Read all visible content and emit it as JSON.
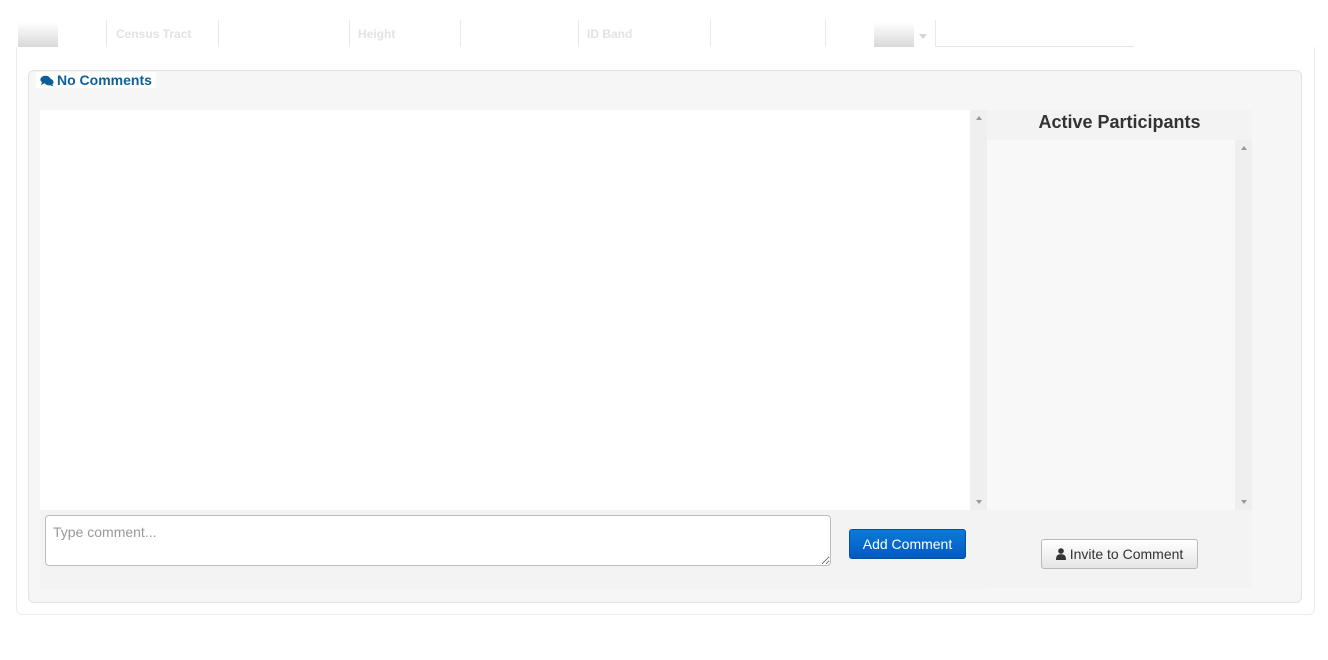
{
  "table_header": {
    "columns": [
      "Census Tract",
      "Height",
      "ID Band"
    ]
  },
  "comments": {
    "legend": "No Comments",
    "input_placeholder": "Type comment...",
    "add_button": "Add Comment"
  },
  "participants": {
    "title": "Active Participants",
    "invite_button": "Invite to Comment"
  },
  "icons": {
    "comments": "comments-icon",
    "user": "user-icon"
  },
  "colors": {
    "legend": "#0e5f97",
    "primary_button": "#0a6ed1"
  }
}
